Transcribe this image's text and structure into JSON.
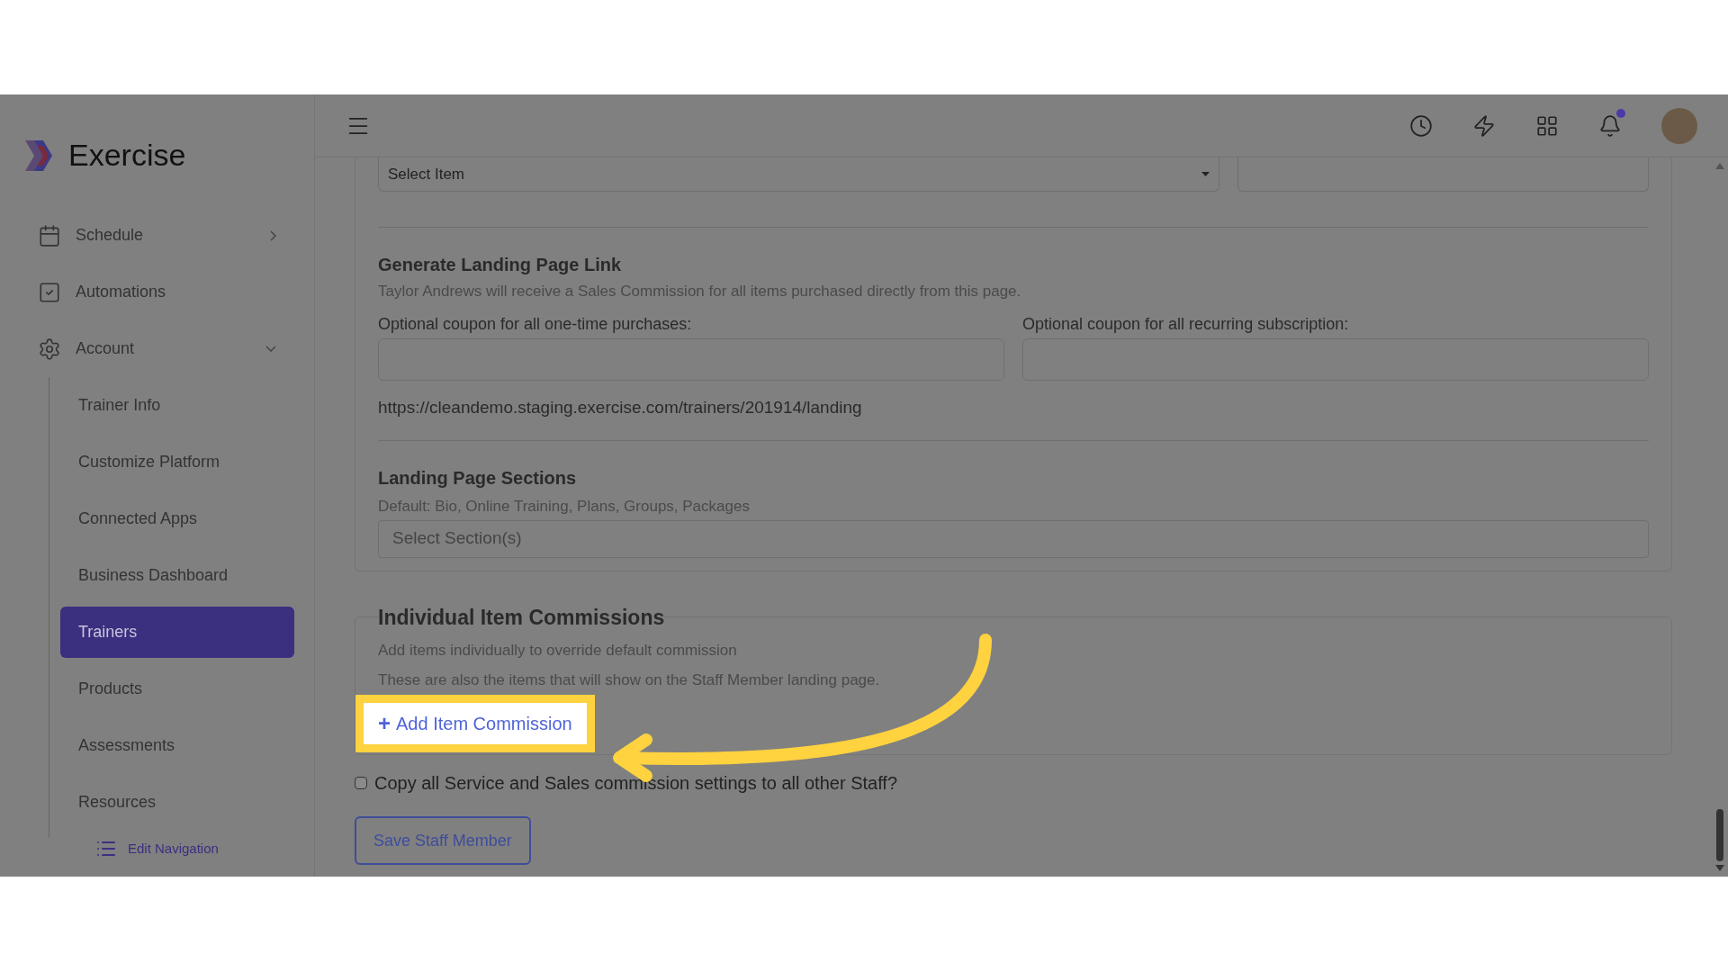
{
  "brand": {
    "name": "Exercise"
  },
  "sidebar": {
    "items": [
      {
        "label": "Schedule",
        "expandable": true,
        "expanded": false,
        "selected": false
      },
      {
        "label": "Automations",
        "expandable": false,
        "selected": false
      },
      {
        "label": "Account",
        "expandable": true,
        "expanded": true,
        "selected": false,
        "children": [
          {
            "label": "Trainer Info",
            "selected": false
          },
          {
            "label": "Customize Platform",
            "selected": false
          },
          {
            "label": "Connected Apps",
            "selected": false
          },
          {
            "label": "Business Dashboard",
            "selected": false
          },
          {
            "label": "Trainers",
            "selected": true
          },
          {
            "label": "Products",
            "selected": false
          },
          {
            "label": "Assessments",
            "selected": false
          },
          {
            "label": "Resources",
            "selected": false
          }
        ]
      }
    ],
    "edit_link": "Edit Navigation"
  },
  "header": {
    "has_notification": true
  },
  "form": {
    "item_select": {
      "placeholder": "Select Item"
    },
    "landing": {
      "title": "Generate Landing Page Link",
      "description": "Taylor Andrews will receive a Sales Commission for all items purchased directly from this page.",
      "coupons": [
        {
          "label": "Optional coupon for all one-time purchases:"
        },
        {
          "label": "Optional coupon for all recurring subscription:"
        }
      ],
      "url": "https://cleandemo.staging.exercise.com/trainers/201914/landing"
    },
    "sections": {
      "title": "Landing Page Sections",
      "description": "Default: Bio, Online Training, Plans, Groups, Packages",
      "placeholder": "Select Section(s)"
    },
    "commissions": {
      "title": "Individual Item Commissions",
      "lines": [
        "Add items individually to override default commission",
        "These are also the items that will show on the Staff Member landing page."
      ],
      "add_button": {
        "icon": "+",
        "label": "Add Item Commission",
        "highlighted": true
      }
    },
    "copy_setting": {
      "label": "Copy all Service and Sales commission settings to all other Staff?",
      "checked": false
    },
    "save_button": "Save Staff Member"
  }
}
